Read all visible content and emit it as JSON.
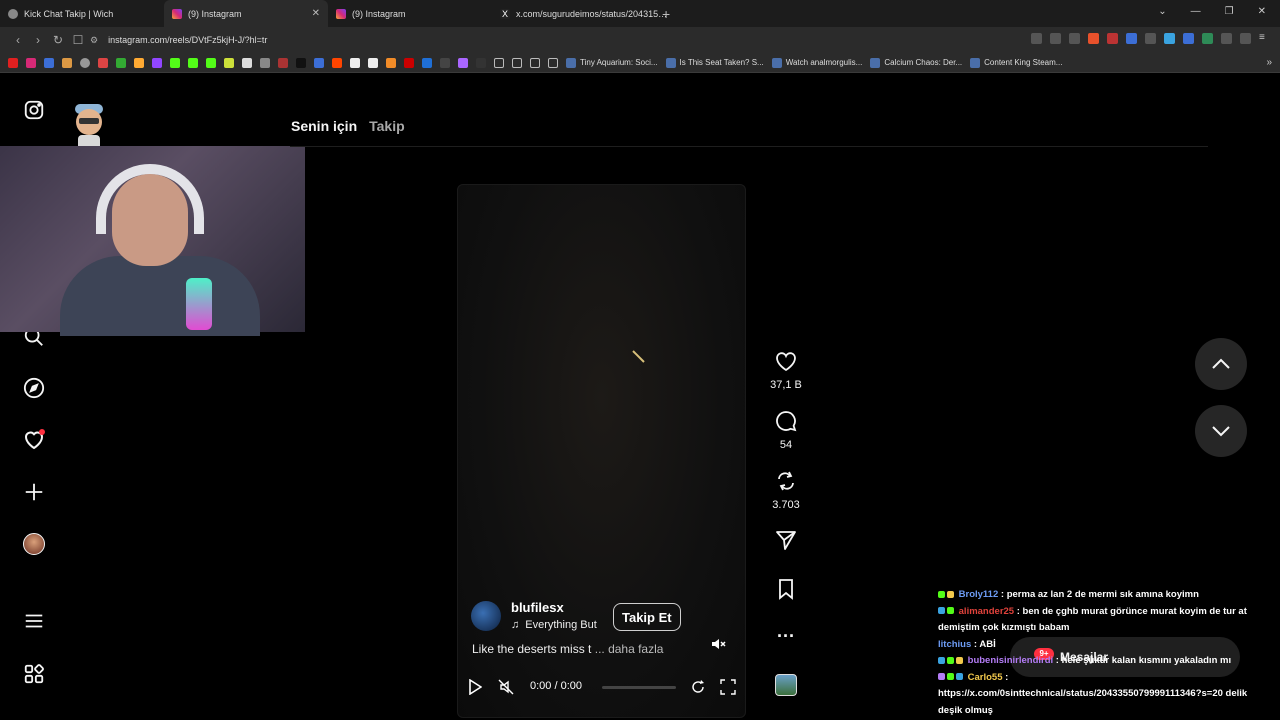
{
  "browser": {
    "tabs": [
      {
        "label": "Kick Chat Takip | Wich",
        "active": false
      },
      {
        "label": "(9) Instagram",
        "active": true
      },
      {
        "label": "(9) Instagram",
        "active": false
      },
      {
        "label": "x.com/sugurudeimos/status/204315…",
        "active": false
      }
    ],
    "url": "instagram.com/reels/DVtFz5kjH-J/?hl=tr",
    "bookmarks": [
      "Tiny Aquarium: Soci...",
      "Is This Seat Taken? S...",
      "Watch analmorgulis...",
      "Calcium Chaos: Der...",
      "Content King Steam..."
    ]
  },
  "feed": {
    "tab_for_you": "Senin için",
    "tab_following": "Takip"
  },
  "reel": {
    "username": "blufilesx",
    "music": "Everything But",
    "follow_label": "Takip Et",
    "caption": "Like the deserts miss t",
    "caption_more": "... daha fazla",
    "time": "0:00 / 0:00",
    "progress": 0
  },
  "actions": {
    "likes": "37,1 B",
    "comments": "54",
    "reposts": "3.703"
  },
  "messages": {
    "label": "Mesajlar",
    "badge": "9+"
  },
  "chat": [
    {
      "user": "Broly112",
      "color": "#6d9cf5",
      "text": ": perma az lan 2 de mermi sık amına koyimn"
    },
    {
      "user": "alimander25",
      "color": "#e0423b",
      "text": ": ben de çghb murat görünce murat koyim de tur at demiştim çok kızmıştı babam"
    },
    {
      "user": "litchius",
      "color": "#6d9cf5",
      "text": ": ABİ"
    },
    {
      "user": "bubenisinirlendirdi",
      "color": "#b37cf5",
      "text": ": hele şükür kalan kısmını yakaladın mı"
    },
    {
      "user": "Carlo55",
      "color": "#f2c94c",
      "text": ":"
    },
    {
      "user": "",
      "color": "#b37cf5",
      "text": "https://x.com/0sinttechnical/status/2043355079999111346?s=20 delik deşik olmuş"
    }
  ],
  "colors": {
    "background": "#000000",
    "like_badge": "#ff3040"
  }
}
